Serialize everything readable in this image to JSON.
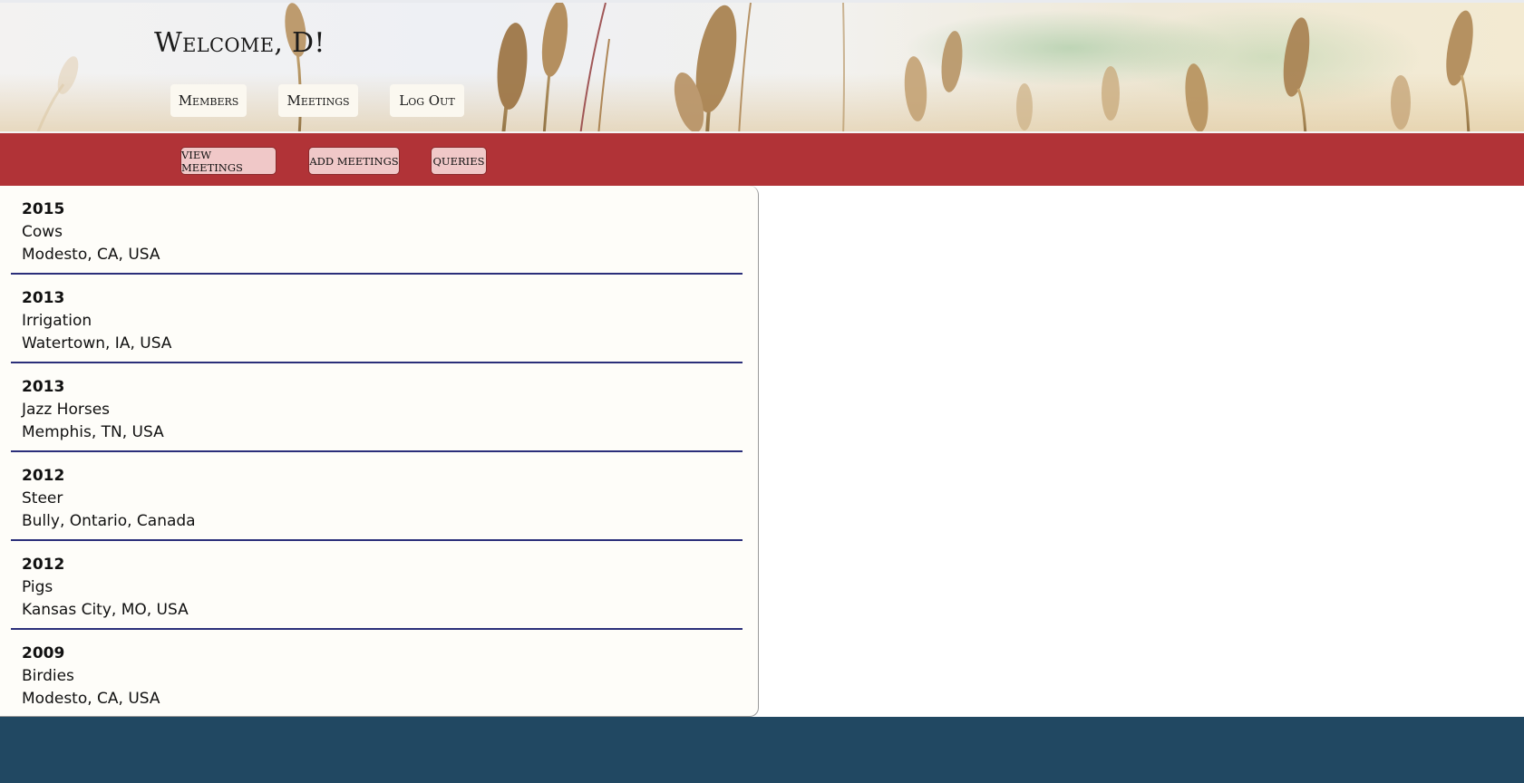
{
  "header": {
    "welcome": "Welcome, D!",
    "nav": [
      {
        "label": "Members"
      },
      {
        "label": "Meetings"
      },
      {
        "label": "Log Out"
      }
    ]
  },
  "subnav": {
    "buttons": [
      {
        "label": "VIEW MEETINGS"
      },
      {
        "label": "ADD MEETINGS"
      },
      {
        "label": "QUERIES"
      }
    ]
  },
  "meetings": [
    {
      "year": "2015",
      "topic": "Cows",
      "location": "Modesto, CA, USA"
    },
    {
      "year": "2013",
      "topic": "Irrigation",
      "location": "Watertown, IA, USA"
    },
    {
      "year": "2013",
      "topic": "Jazz Horses",
      "location": "Memphis, TN, USA"
    },
    {
      "year": "2012",
      "topic": "Steer",
      "location": "Bully, Ontario, Canada"
    },
    {
      "year": "2012",
      "topic": "Pigs",
      "location": "Kansas City, MO, USA"
    },
    {
      "year": "2009",
      "topic": "Birdies",
      "location": "Modesto, CA, USA"
    }
  ],
  "colors": {
    "subnav_bar": "#b13337",
    "subnav_button": "#f0c8c8",
    "divider": "#2b2f7a",
    "footer": "#214862",
    "list_background": "#fefdf9"
  }
}
